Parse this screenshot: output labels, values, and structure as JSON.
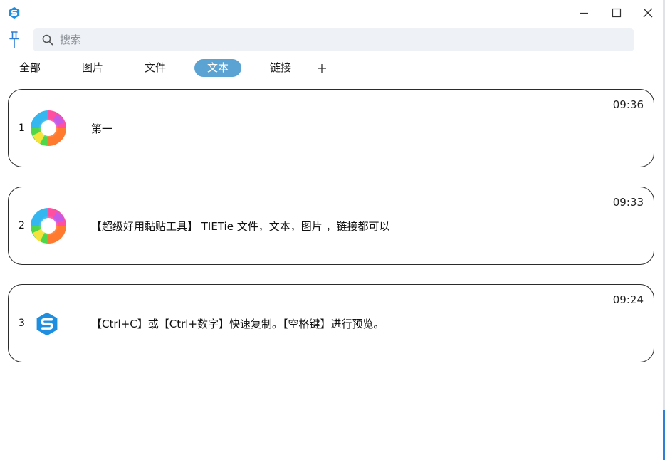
{
  "window": {
    "icon": "app-logo-icon",
    "controls": [
      "minimize-icon",
      "maximize-icon",
      "close-icon"
    ]
  },
  "toolbar": {
    "pin_icon": "pin-icon",
    "search": {
      "icon": "search-icon",
      "placeholder": "搜索",
      "value": ""
    }
  },
  "tabs": [
    {
      "label": "全部",
      "active": false
    },
    {
      "label": "图片",
      "active": false
    },
    {
      "label": "文件",
      "active": false
    },
    {
      "label": "文本",
      "active": true
    },
    {
      "label": "链接",
      "active": false
    }
  ],
  "add_tab_icon": "plus-icon",
  "items": [
    {
      "index": "1",
      "icon": "colorful-swirl-icon",
      "text": "第一",
      "time": "09:36"
    },
    {
      "index": "2",
      "icon": "colorful-swirl-icon",
      "text": "【超级好用黏贴工具】 TIETie  文件，文本，图片 ，链接都可以",
      "time": "09:33"
    },
    {
      "index": "3",
      "icon": "app-logo-icon",
      "text": "【Ctrl+C】或【Ctrl+数字】快速复制。【空格键】进行预览。",
      "time": "09:24"
    }
  ],
  "colors": {
    "accent": "#5aa3d3",
    "logo_blue": "#1e8fe0",
    "search_bg": "#eef1f6"
  }
}
